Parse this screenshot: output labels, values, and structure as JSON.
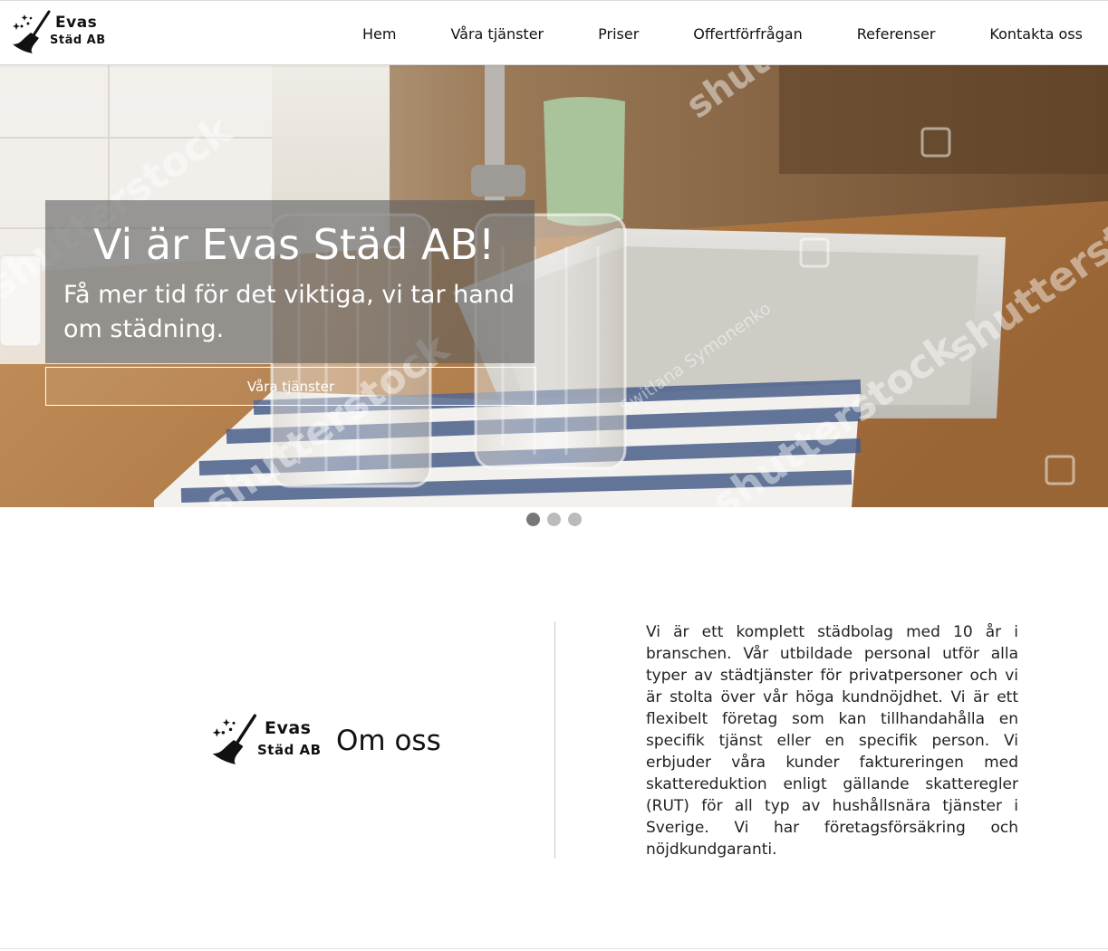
{
  "brand": {
    "line1": "Evas",
    "line2": "Städ AB"
  },
  "nav": {
    "items": [
      {
        "label": "Hem"
      },
      {
        "label": "Våra tjänster"
      },
      {
        "label": "Priser"
      },
      {
        "label": "Offertförfrågan"
      },
      {
        "label": "Referenser"
      },
      {
        "label": "Kontakta oss"
      }
    ]
  },
  "hero": {
    "title": "Vi är Evas Städ AB!",
    "subtitle": "Få mer tid för det viktiga, vi tar hand om städning.",
    "button_label": "Våra tjänster",
    "watermark_main": "shutterstock",
    "watermark_author": "Switlana Symonenko"
  },
  "carousel": {
    "slides": 3,
    "active_index": 0
  },
  "about": {
    "title": "Om oss",
    "text": "Vi är ett komplett städbolag med 10 år i branschen. Vår utbildade personal utför alla typer av städtjänster för privatpersoner och vi är stolta över vår höga kundnöjdhet. Vi är ett flexibelt företag som kan tillhandahålla en specifik tjänst eller en specifik person. Vi erbjuder våra kunder faktureringen med skattereduktion enligt gällande skatteregler (RUT) för all typ av hushållsnära tjänster i Sverige. Vi har företagsförsäkring och nöjdkundgaranti."
  },
  "colors": {
    "text": "#111111",
    "overlay": "#5f5f5f",
    "dot_active": "#777777",
    "dot_inactive": "#bbbbbb"
  }
}
